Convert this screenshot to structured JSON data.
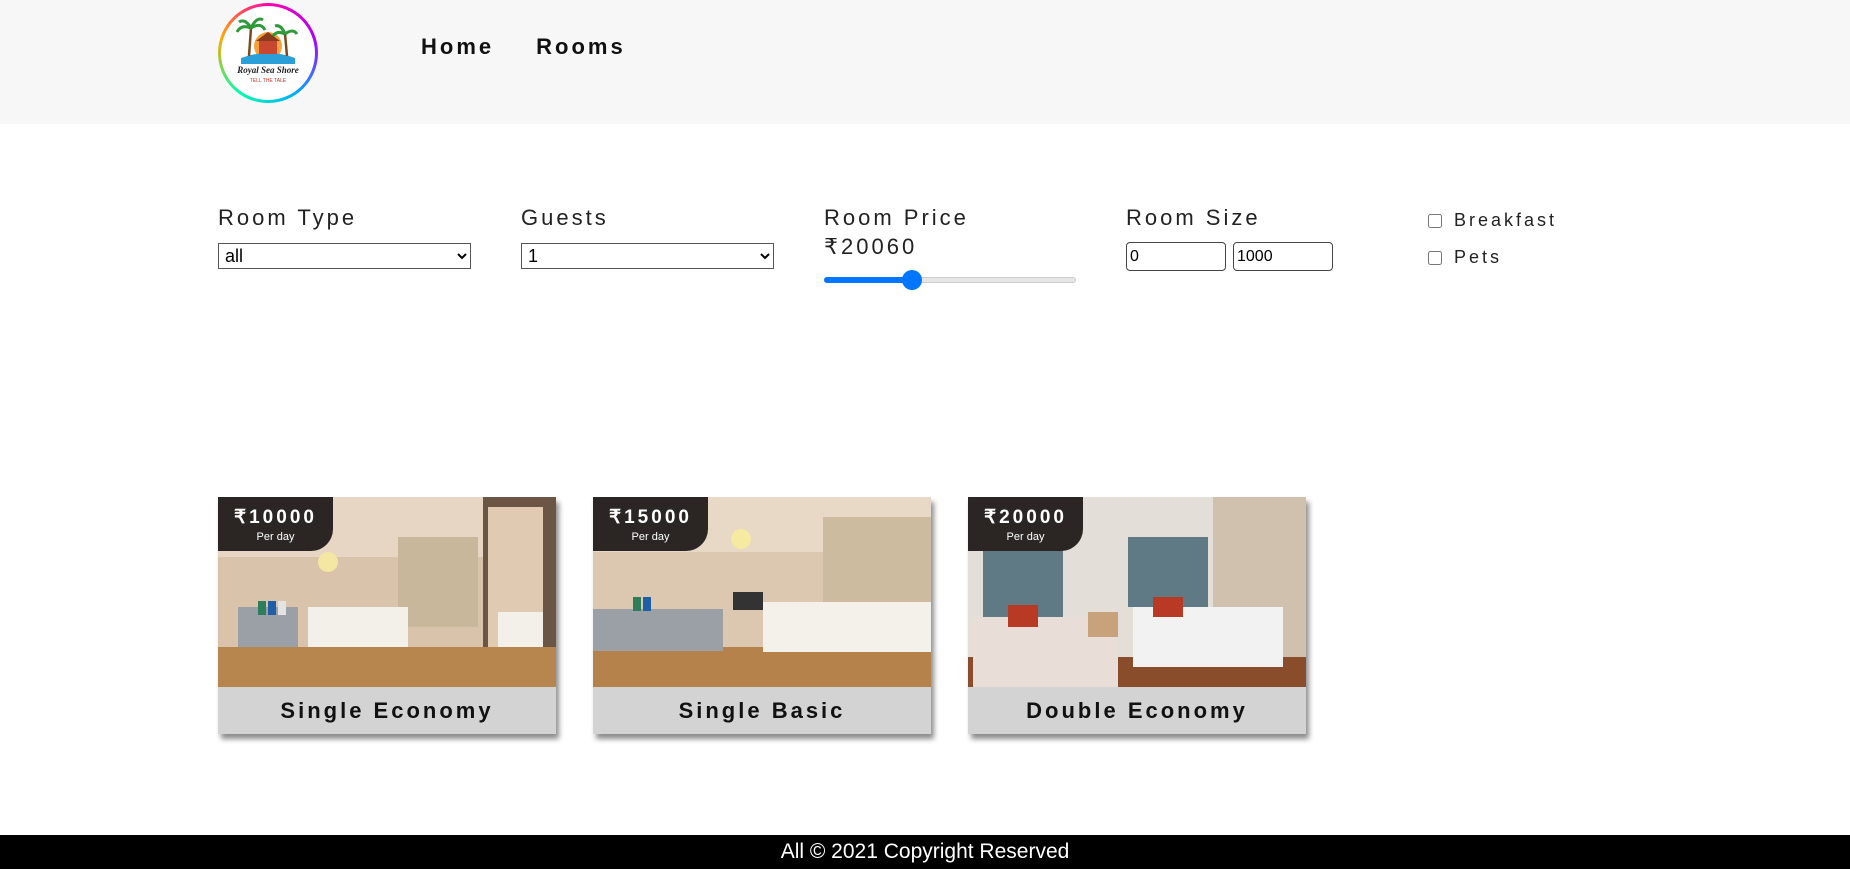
{
  "header": {
    "logo": {
      "text_top": "Royal Sea Shore",
      "text_bottom": "TELL THE TALE"
    },
    "nav": [
      "Home",
      "Rooms"
    ]
  },
  "filters": {
    "room_type": {
      "label": "Room Type",
      "value": "all"
    },
    "guests": {
      "label": "Guests",
      "value": "1"
    },
    "room_price": {
      "label": "Room Price",
      "value": "₹20060",
      "slider_level": 0.35
    },
    "room_size": {
      "label": "Room Size",
      "min": "0",
      "max": "1000"
    },
    "checkboxes": [
      {
        "label": "Breakfast",
        "checked": false
      },
      {
        "label": "Pets",
        "checked": false
      }
    ]
  },
  "rooms": [
    {
      "price": "₹10000",
      "per": "Per day",
      "name": "Single Economy"
    },
    {
      "price": "₹15000",
      "per": "Per day",
      "name": "Single Basic"
    },
    {
      "price": "₹20000",
      "per": "Per day",
      "name": "Double Economy"
    }
  ],
  "footer": {
    "text": "All © 2021 Copyright Reserved"
  },
  "colors": {
    "accent": "#0075ff",
    "header_bg": "#f7f7f7",
    "card_bg": "#d3d3d3",
    "price_badge": "#2b2623",
    "footer_bg": "#000000"
  }
}
